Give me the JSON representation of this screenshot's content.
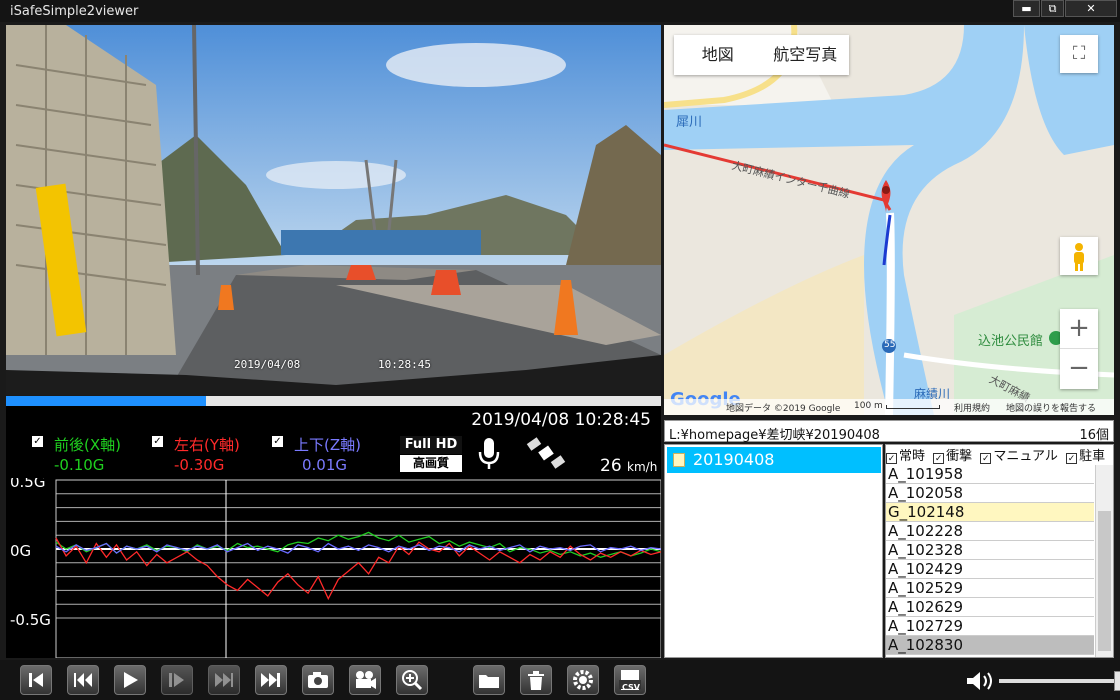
{
  "window": {
    "title": "iSafeSimple2viewer",
    "controls": [
      "minimize-icon",
      "restore-icon",
      "close-icon"
    ]
  },
  "video": {
    "stamp_date": "2019/04/08",
    "stamp_time": "10:28:45",
    "progress_fraction": 0.305
  },
  "sensor": {
    "datetime": "2019/04/08 10:28:45",
    "axes": [
      {
        "label": "前後(X軸)",
        "value": "-0.10G",
        "color": "#1fd01f",
        "checked": true
      },
      {
        "label": "左右(Y軸)",
        "value": "-0.30G",
        "color": "#ff2a2a",
        "checked": true
      },
      {
        "label": "上下(Z軸)",
        "value": "0.01G",
        "color": "#7a7aff",
        "checked": true
      }
    ],
    "hd_line1": "Full HD",
    "hd_line2": "高画質",
    "mic_icon": "microphone-icon",
    "gps_icon": "satellite-icon",
    "speed_value": "26",
    "speed_unit": "km/h"
  },
  "chart_data": {
    "type": "line",
    "y_tick_labels": [
      "0.5G",
      "0G",
      "-0.5G"
    ],
    "ylim": [
      -0.5,
      0.5
    ],
    "grid": true,
    "series": [
      {
        "name": "前後(X軸)",
        "color": "#22cc22",
        "values": [
          0.05,
          0.0,
          0.03,
          -0.02,
          0.01,
          0.04,
          -0.03,
          0.02,
          0.0,
          0.03,
          -0.01,
          0.02,
          0.01,
          -0.02,
          0.03,
          0.0,
          0.02,
          -0.01,
          0.04,
          0.01,
          0.02,
          0.0,
          -0.02,
          0.03,
          0.05,
          0.04,
          0.08,
          0.06,
          0.1,
          0.07,
          0.09,
          0.12,
          0.08,
          0.06,
          0.1,
          0.05,
          0.07,
          0.09,
          0.04,
          0.06,
          0.02,
          0.05,
          0.03,
          0.01,
          0.04,
          -0.02,
          0.01,
          0.0,
          -0.03,
          -0.01,
          -0.04,
          -0.02,
          -0.05,
          -0.03,
          -0.06,
          -0.04,
          -0.02,
          -0.05,
          -0.03,
          0.0,
          -0.02
        ]
      },
      {
        "name": "左右(Y軸)",
        "color": "#ff2a2a",
        "values": [
          0.08,
          -0.05,
          0.02,
          -0.1,
          0.04,
          -0.06,
          0.03,
          -0.08,
          -0.02,
          -0.12,
          -0.04,
          -0.1,
          -0.06,
          -0.02,
          -0.08,
          -0.12,
          -0.2,
          -0.26,
          -0.3,
          -0.22,
          -0.28,
          -0.34,
          -0.24,
          -0.18,
          -0.26,
          -0.32,
          -0.2,
          -0.36,
          -0.22,
          -0.16,
          -0.1,
          -0.18,
          -0.06,
          -0.1,
          0.02,
          -0.04,
          0.05,
          0.0,
          -0.02,
          0.04,
          -0.05,
          0.02,
          -0.03,
          -0.08,
          -0.02,
          -0.06,
          -0.1,
          -0.04,
          -0.08,
          -0.02,
          -0.06,
          0.02,
          -0.04,
          -0.08,
          -0.03,
          -0.06,
          -0.02,
          -0.05,
          -0.01,
          -0.04,
          -0.02
        ]
      },
      {
        "name": "上下(Z軸)",
        "color": "#6b6bff",
        "values": [
          0.02,
          -0.02,
          0.03,
          -0.01,
          0.01,
          0.04,
          -0.03,
          0.02,
          0.0,
          0.02,
          -0.02,
          0.03,
          0.01,
          -0.01,
          0.02,
          0.0,
          0.03,
          -0.02,
          0.01,
          0.04,
          -0.01,
          0.02,
          0.0,
          -0.03,
          0.03,
          0.01,
          -0.02,
          0.04,
          0.0,
          0.02,
          -0.01,
          0.03,
          0.01,
          -0.02,
          0.02,
          0.0,
          0.03,
          -0.01,
          0.02,
          0.01,
          -0.02,
          0.03,
          0.0,
          0.02,
          -0.01,
          0.01,
          0.03,
          -0.02,
          0.02,
          0.0,
          0.01,
          -0.01,
          0.02,
          0.03,
          -0.02,
          0.01,
          0.0,
          0.02,
          -0.01,
          0.01,
          0.0
        ]
      }
    ]
  },
  "map": {
    "tab_map": "地図",
    "tab_aerial": "航空写真",
    "labels": [
      "犀川",
      "大町麻績インター千曲線",
      "込池公民館",
      "麻績川",
      "大町麻績",
      "55"
    ],
    "logo": "Google",
    "copyright": "地図データ ©2019 Google",
    "scale": "100 m",
    "terms": "利用規約",
    "report": "地図の誤りを報告する"
  },
  "explorer": {
    "path": "L:¥homepage¥差切峡¥20190408",
    "count": "16個",
    "folder": "20190408",
    "filters": [
      "常時",
      "衝撃",
      "マニュアル",
      "駐車"
    ],
    "files": [
      {
        "name": "A_101958",
        "style": ""
      },
      {
        "name": "A_102058",
        "style": ""
      },
      {
        "name": "G_102148",
        "style": "sel"
      },
      {
        "name": "A_102228",
        "style": ""
      },
      {
        "name": "A_102328",
        "style": ""
      },
      {
        "name": "A_102429",
        "style": ""
      },
      {
        "name": "A_102529",
        "style": ""
      },
      {
        "name": "A_102629",
        "style": ""
      },
      {
        "name": "A_102729",
        "style": ""
      },
      {
        "name": "A_102830",
        "style": "dark"
      }
    ]
  },
  "toolbar": {
    "buttons": [
      "skip-start-icon",
      "rewind-icon",
      "play-icon",
      "step-frame-icon",
      "fast-forward-icon",
      "skip-end-icon",
      "snapshot-icon",
      "video-camera-icon",
      "zoom-in-icon",
      "folder-icon",
      "trash-icon",
      "settings-icon",
      "csv-export-icon"
    ],
    "csv_label": "CSV",
    "volume_fraction": 0.93
  }
}
